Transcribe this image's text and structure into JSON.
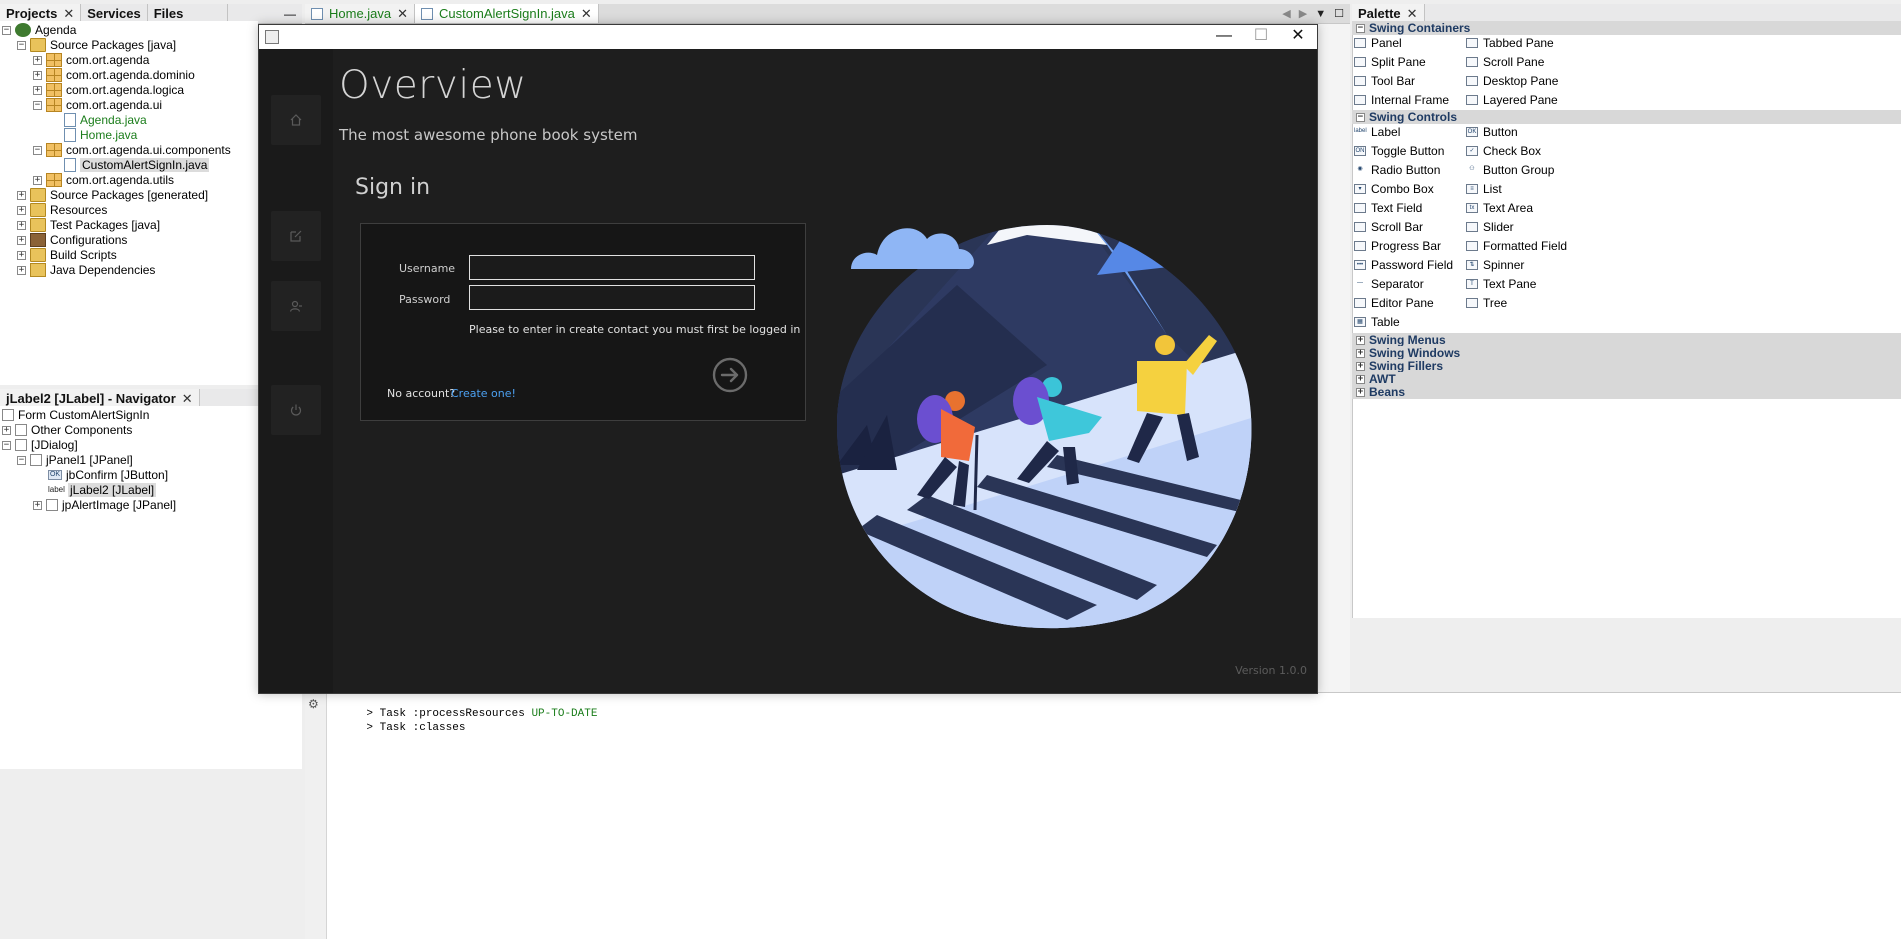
{
  "projects_panel": {
    "tabs": [
      {
        "label": "Projects",
        "close": "✕"
      },
      {
        "label": "Services"
      },
      {
        "label": "Files"
      }
    ],
    "minimize": "—",
    "tree": {
      "root": "Agenda",
      "source_packages": "Source Packages [java]",
      "packages": [
        "com.ort.agenda",
        "com.ort.agenda.dominio",
        "com.ort.agenda.logica",
        "com.ort.agenda.ui"
      ],
      "ui_files": [
        "Agenda.java",
        "Home.java"
      ],
      "components_package": "com.ort.agenda.ui.components",
      "components_file": "CustomAlertSignIn.java",
      "utils_package": "com.ort.agenda.utils",
      "others": [
        "Source Packages [generated]",
        "Resources",
        "Test Packages [java]",
        "Configurations",
        "Build Scripts",
        "Java Dependencies"
      ]
    }
  },
  "navigator_panel": {
    "title": "jLabel2 [JLabel] - Navigator",
    "close": "✕",
    "tree": {
      "form": "Form CustomAlertSignIn",
      "other_components": "Other Components",
      "jdialog": "[JDialog]",
      "jpanel1": "jPanel1 [JPanel]",
      "jbconfirm": "jbConfirm [JButton]",
      "jlabel2": "jLabel2 [JLabel]",
      "jpalertimage": "jpAlertImage [JPanel]"
    }
  },
  "editor_tabs": [
    {
      "label": "Home.java",
      "close": "✕"
    },
    {
      "label": "CustomAlertSignIn.java",
      "close": "✕"
    }
  ],
  "palette": {
    "title": "Palette",
    "close": "✕",
    "swing_containers": "Swing Containers",
    "containers": [
      [
        "Panel",
        "Tabbed Pane"
      ],
      [
        "Split Pane",
        "Scroll Pane"
      ],
      [
        "Tool Bar",
        "Desktop Pane"
      ],
      [
        "Internal Frame",
        "Layered Pane"
      ]
    ],
    "swing_controls": "Swing Controls",
    "controls": [
      [
        "Label",
        "Button"
      ],
      [
        "Toggle Button",
        "Check Box"
      ],
      [
        "Radio Button",
        "Button Group"
      ],
      [
        "Combo Box",
        "List"
      ],
      [
        "Text Field",
        "Text Area"
      ],
      [
        "Scroll Bar",
        "Slider"
      ],
      [
        "Progress Bar",
        "Formatted Field"
      ],
      [
        "Password Field",
        "Spinner"
      ],
      [
        "Separator",
        "Text Pane"
      ],
      [
        "Editor Pane",
        "Tree"
      ],
      [
        "Table",
        ""
      ]
    ],
    "collapsed_categories": [
      "Swing Menus",
      "Swing Windows",
      "Swing Fillers",
      "AWT",
      "Beans"
    ]
  },
  "output": {
    "lines": [
      {
        "prefix": "> Task :processResources ",
        "status": "UP-TO-DATE"
      },
      {
        "prefix": "> Task :classes",
        "status": ""
      }
    ]
  },
  "dialog": {
    "window_controls": {
      "minimize": "—",
      "maximize": "☐",
      "close": "✕"
    },
    "overview_title": "Overview",
    "subtitle": "The most awesome phone book system",
    "signin_title": "Sign in",
    "username_label": "Username",
    "username_value": "",
    "password_label": "Password",
    "password_value": "",
    "hint": "Please to enter in create contact you must first be logged in",
    "no_account": "No account?",
    "create_link": "Create one!",
    "version": "Version 1.0.0",
    "sidebar_icons": [
      "home-icon",
      "edit-icon",
      "user-icon",
      "power-icon"
    ],
    "colors": {
      "background": "#1e1e1e",
      "sidebar": "#1a1a1a",
      "link": "#4ca0f0",
      "illustration_sky": "#8fb6f5",
      "illustration_mountain": "#1f2a4a"
    }
  }
}
